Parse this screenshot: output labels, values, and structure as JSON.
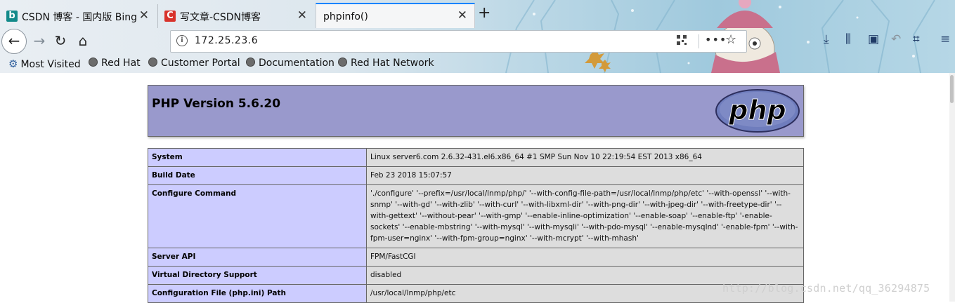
{
  "browser": {
    "tabs": [
      {
        "title": "CSDN 博客 - 国内版 Bing",
        "icon": "bing-icon",
        "active": false
      },
      {
        "title": "写文章-CSDN博客",
        "icon": "csdn-icon",
        "active": false
      },
      {
        "title": "phpinfo()",
        "icon": "",
        "active": true
      }
    ],
    "url": "172.25.23.6",
    "bookmarks": [
      {
        "label": "Most Visited",
        "icon": "gear-icon"
      },
      {
        "label": "Red Hat",
        "icon": "globe-icon"
      },
      {
        "label": "Customer Portal",
        "icon": "globe-icon"
      },
      {
        "label": "Documentation",
        "icon": "globe-icon"
      },
      {
        "label": "Red Hat Network",
        "icon": "globe-icon"
      }
    ],
    "accent": "#0a84ff"
  },
  "phpinfo": {
    "title": "PHP Version 5.6.20",
    "logo_text": "php",
    "header_color": "#9999cc",
    "label_color": "#ccccff",
    "value_color": "#dddddd",
    "rows": [
      {
        "label": "System",
        "value": "Linux server6.com 2.6.32-431.el6.x86_64 #1 SMP Sun Nov 10 22:19:54 EST 2013 x86_64"
      },
      {
        "label": "Build Date",
        "value": "Feb 23 2018 15:07:57"
      },
      {
        "label": "Configure Command",
        "value": "'./configure' '--prefix=/usr/local/lnmp/php/' '--with-config-file-path=/usr/local/lnmp/php/etc' '--with-openssl' '--with-snmp' '--with-gd' '--with-zlib' '--with-curl' '--with-libxml-dir' '--with-png-dir' '--with-jpeg-dir' '--with-freetype-dir' '--with-gettext' '--without-pear' '--with-gmp' '--enable-inline-optimization' '--enable-soap' '--enable-ftp' '-enable-sockets' '--enable-mbstring' '--with-mysql' '--with-mysqli' '--with-pdo-mysql' '--enable-mysqlnd' '-enable-fpm' '--with-fpm-user=nginx' '--with-fpm-group=nginx' '--with-mcrypt' '--with-mhash'"
      },
      {
        "label": "Server API",
        "value": "FPM/FastCGI"
      },
      {
        "label": "Virtual Directory Support",
        "value": "disabled"
      },
      {
        "label": "Configuration File (php.ini) Path",
        "value": "/usr/local/lnmp/php/etc"
      }
    ]
  },
  "watermark": "http://blog.csdn.net/qq_36294875"
}
